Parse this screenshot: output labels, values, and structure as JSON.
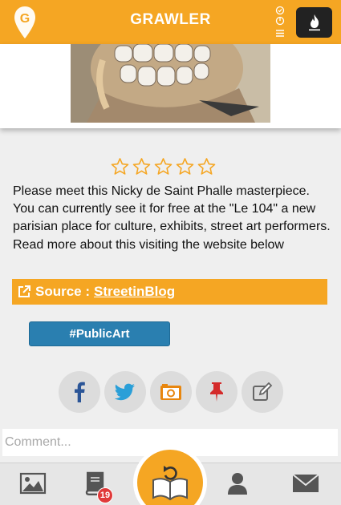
{
  "header": {
    "title": "GRAWLER",
    "logo_icon": "grawler-logo-icon",
    "action_icon": "flame-icon"
  },
  "post": {
    "image_alt": "sculpture-photo",
    "rating": {
      "value": 0,
      "max": 5
    },
    "description": "Please meet this Nicky de Saint Phalle masterpiece. You can currently see it for free at the \"Le 104\" a new parisian place for culture, exhibits, street art performers. Read more about this visiting the website below",
    "source": {
      "label": "Source :",
      "link_text": "StreetinBlog"
    },
    "tag": "#PublicArt"
  },
  "share": {
    "buttons": [
      "facebook-icon",
      "twitter-icon",
      "camera-icon",
      "pin-icon",
      "edit-icon"
    ]
  },
  "comment": {
    "placeholder": "Comment..."
  },
  "bottom_nav": {
    "items": [
      "gallery-icon",
      "journal-icon",
      "refresh-book-icon",
      "profile-icon",
      "mail-icon"
    ],
    "badge_count": "19"
  },
  "colors": {
    "accent": "#f5a623",
    "tag_blue": "#2a7fb0",
    "badge_red": "#e03a3a"
  }
}
